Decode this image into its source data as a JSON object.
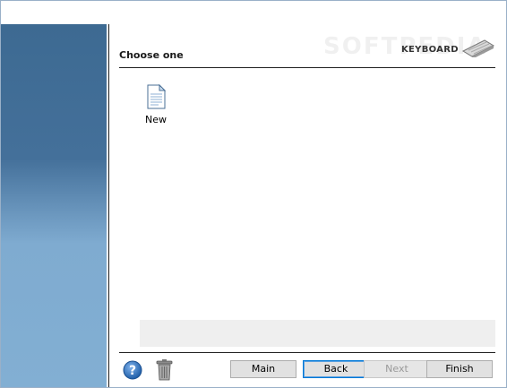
{
  "header": {
    "title": "Choose one",
    "brand_label": "KEYBOARD",
    "watermark": "SOFTPEDIA"
  },
  "items": [
    {
      "label": "New",
      "icon": "new-document-icon"
    }
  ],
  "footer": {
    "help_icon": "help-icon",
    "trash_icon": "trash-icon",
    "buttons": {
      "main": "Main",
      "back": "Back",
      "next": "Next",
      "finish": "Finish"
    },
    "next_disabled": true
  },
  "colors": {
    "sidebar_top": "#3d6a92",
    "sidebar_bottom": "#82afd3",
    "focus_border": "#0078d7",
    "info_panel": "#efefef"
  }
}
